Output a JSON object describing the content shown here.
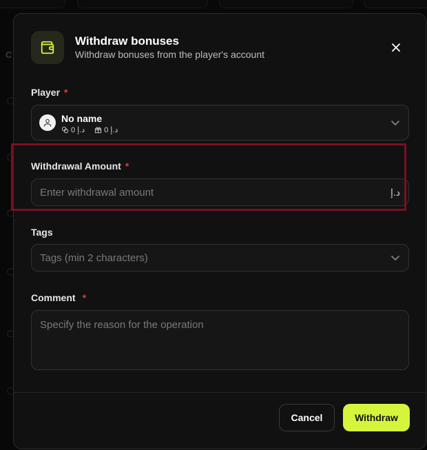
{
  "background": {
    "side_text": "C"
  },
  "modal": {
    "title": "Withdraw bonuses",
    "subtitle": "Withdraw bonuses from the player's account",
    "accent_color": "#d4f53c",
    "required_color": "#e03a3a",
    "highlight_color": "#7a1020"
  },
  "player": {
    "label": "Player",
    "required_mark": "*",
    "name": "No name",
    "balance_1": "0",
    "currency_1": "د.إ",
    "balance_2": "0",
    "currency_2": "د.إ",
    "icons": [
      "coins-icon",
      "gift-icon",
      "user-icon",
      "chevron-down-icon"
    ]
  },
  "amount": {
    "label": "Withdrawal Amount",
    "required_mark": "*",
    "placeholder": "Enter withdrawal amount",
    "currency": "د.إ"
  },
  "tags": {
    "label": "Tags",
    "placeholder": "Tags (min 2 characters)"
  },
  "comment": {
    "label": "Comment",
    "required_mark": "*",
    "placeholder": "Specify the reason for the operation"
  },
  "footer": {
    "cancel_label": "Cancel",
    "withdraw_label": "Withdraw"
  }
}
